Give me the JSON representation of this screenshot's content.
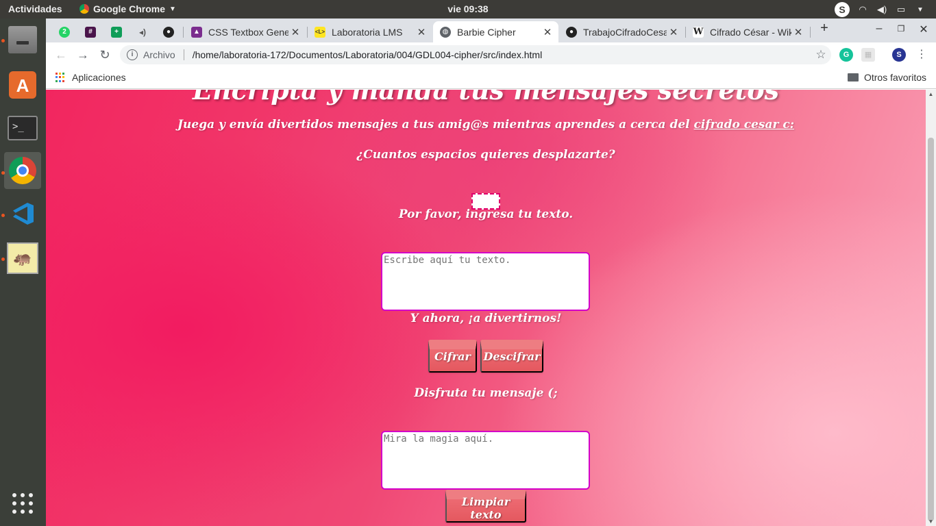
{
  "topbar": {
    "activities": "Actividades",
    "app_name": "Google Chrome",
    "clock": "vie 09:38",
    "skype_letter": "S"
  },
  "dock": {
    "items": [
      "files",
      "software-center",
      "terminal",
      "chrome",
      "vscode",
      "hippo-app",
      "show-applications"
    ]
  },
  "tabs": [
    {
      "title": "",
      "favicon": "whatsapp-2",
      "pinned": true
    },
    {
      "title": "",
      "favicon": "slack",
      "pinned": true
    },
    {
      "title": "",
      "favicon": "sheets",
      "pinned": true
    },
    {
      "title": "",
      "favicon": "audio",
      "pinned": true
    },
    {
      "title": "",
      "favicon": "github",
      "pinned": true
    },
    {
      "title": "CSS Textbox Generator",
      "favicon": "css-generator",
      "active": false
    },
    {
      "title": "Laboratoria LMS",
      "favicon": "laboratoria",
      "active": false
    },
    {
      "title": "Barbie Cipher",
      "favicon": "globe",
      "active": true
    },
    {
      "title": "TrabajoCifradoCesar",
      "favicon": "github",
      "active": false
    },
    {
      "title": "Cifrado César - Wikipedia",
      "favicon": "wikipedia",
      "active": false
    }
  ],
  "toolbar": {
    "scheme": "Archivo",
    "url": "/home/laboratoria-172/Documentos/Laboratoria/004/GDL004-cipher/src/index.html",
    "profile_letter": "S"
  },
  "bookmarks": {
    "apps_label": "Aplicaciones",
    "other_label": "Otros favoritos"
  },
  "page": {
    "header_partial": "Encripta y manda tus mensajes secretos",
    "intro_prefix": "Juega y envía divertidos mensajes a tus amig@s mientras aprendes a cerca del ",
    "intro_link": "cifrado cesar c:",
    "offset_question": "¿Cuantos espacios quieres desplazarte?",
    "text_prompt": "Por favor, ingresa tu texto.",
    "input_placeholder": "Escribe aquí tu texto.",
    "fun_prompt": "Y ahora, ¡a divertirnos!",
    "cipher_button": "Cifrar",
    "decipher_button": "Descifrar",
    "enjoy_prompt": "Disfruta tu mensaje (;",
    "output_placeholder": "Mira la magia aquí.",
    "clear_button": "Limpiar texto"
  },
  "colors": {
    "page_pink": "#f2265f",
    "button": "#e4585f",
    "textarea_border": "#d400c8"
  }
}
